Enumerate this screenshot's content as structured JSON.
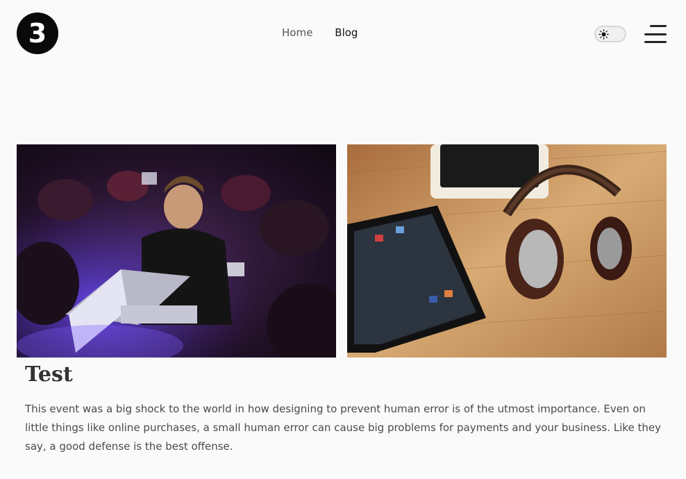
{
  "header": {
    "logo_text": "3",
    "nav": [
      {
        "label": "Home",
        "active": false
      },
      {
        "label": "Blog",
        "active": true
      }
    ],
    "theme_toggle": {
      "icon": "sun-icon",
      "state": "light"
    },
    "menu_icon": "hamburger-menu-icon"
  },
  "gallery": {
    "images": [
      {
        "subject": "person-working-on-laptop-at-event"
      },
      {
        "subject": "tablet-and-headphones-on-wooden-table"
      }
    ]
  },
  "post": {
    "title": "Test",
    "body": "This event was a big shock to the world in how designing to prevent human error is of the utmost importance. Even on little things like online purchases, a small human error can cause big problems for payments and your business. Like they say, a good defense is the best offense."
  },
  "colors": {
    "background": "#fafafa",
    "logo_bg": "#0a0a0a",
    "text": "#4a4a4a"
  }
}
